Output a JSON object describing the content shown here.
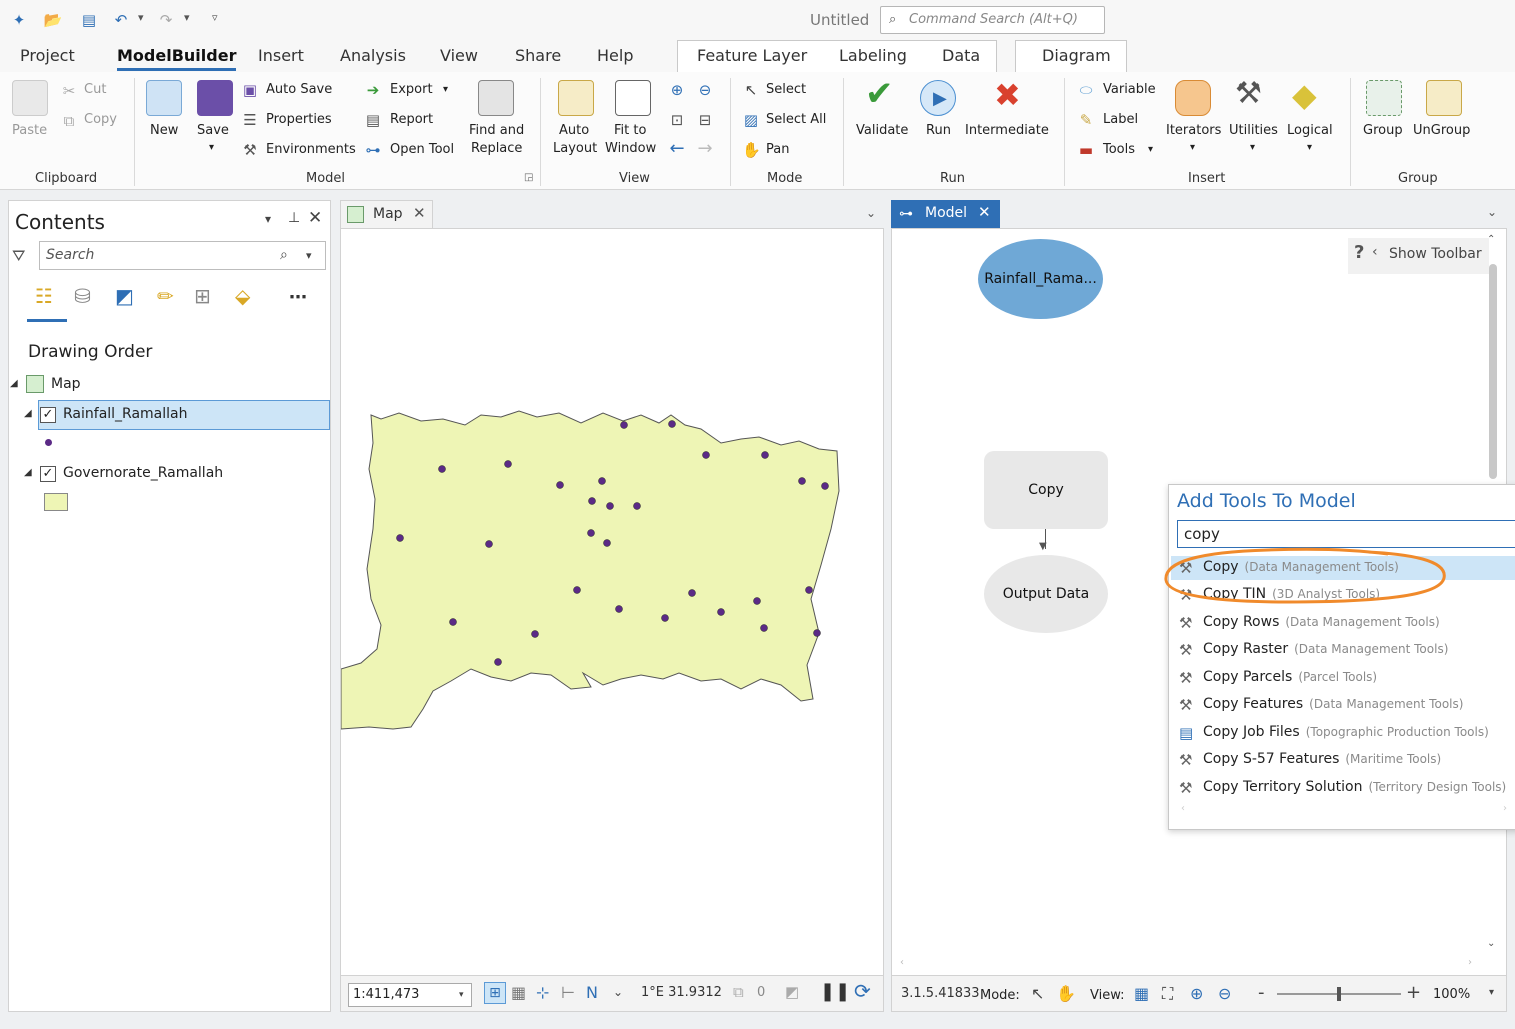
{
  "app": {
    "title": "Untitled",
    "command_search_placeholder": "Command Search (Alt+Q)"
  },
  "tabs": [
    "Project",
    "ModelBuilder",
    "Insert",
    "Analysis",
    "View",
    "Share",
    "Help"
  ],
  "context_tabs": [
    "Feature Layer",
    "Labeling",
    "Data"
  ],
  "diagram_tab": "Diagram",
  "ribbon": {
    "clipboard": {
      "paste": "Paste",
      "cut": "Cut",
      "copy": "Copy",
      "group": "Clipboard"
    },
    "model": {
      "new": "New",
      "save": "Save",
      "auto_save": "Auto Save",
      "properties": "Properties",
      "environments": "Environments",
      "export": "Export",
      "report": "Report",
      "open_tool": "Open Tool",
      "find_and": "Find and",
      "replace": "Replace",
      "group": "Model"
    },
    "view": {
      "auto": "Auto",
      "layout": "Layout",
      "fit_to": "Fit to",
      "window": "Window",
      "group": "View"
    },
    "mode": {
      "select": "Select",
      "select_all": "Select All",
      "pan": "Pan",
      "group": "Mode"
    },
    "run": {
      "validate": "Validate",
      "run": "Run",
      "intermediate": "Intermediate",
      "group": "Run"
    },
    "insert": {
      "variable": "Variable",
      "label": "Label",
      "tools": "Tools",
      "iterators": "Iterators",
      "utilities": "Utilities",
      "logical": "Logical",
      "group": "Insert"
    },
    "grouping": {
      "group_btn": "Group",
      "ungroup": "UnGroup",
      "group": "Group"
    }
  },
  "contents": {
    "title": "Contents",
    "search_placeholder": "Search",
    "drawing_order": "Drawing Order",
    "map_item": "Map",
    "layers": [
      "Rainfall_Ramallah",
      "Governorate_Ramallah"
    ]
  },
  "map_view": {
    "tab": "Map",
    "scale": "1:411,473",
    "coords": "1°E 31.9312",
    "selected_count": "0"
  },
  "model_view": {
    "tab": "Model",
    "show_toolbar": "Show Toolbar",
    "help": "?",
    "nodes": {
      "input": "Rainfall_Rama...",
      "tool": "Copy",
      "output": "Output Data"
    },
    "status_coords": "3.1.5.41833",
    "mode_label": "Mode:",
    "view_label": "View:",
    "zoom": "100%"
  },
  "add_tools": {
    "title": "Add Tools To Model",
    "query": "copy",
    "results": [
      {
        "name": "Copy",
        "category": "(Data Management Tools)"
      },
      {
        "name": "Copy TIN",
        "category": "(3D Analyst Tools)"
      },
      {
        "name": "Copy Rows",
        "category": "(Data Management Tools)"
      },
      {
        "name": "Copy Raster",
        "category": "(Data Management Tools)"
      },
      {
        "name": "Copy Parcels",
        "category": "(Parcel Tools)"
      },
      {
        "name": "Copy Features",
        "category": "(Data Management Tools)"
      },
      {
        "name": "Copy Job Files",
        "category": "(Topographic Production Tools)"
      },
      {
        "name": "Copy S-57 Features",
        "category": "(Maritime Tools)"
      },
      {
        "name": "Copy Territory Solution",
        "category": "(Territory Design Tools)"
      }
    ]
  },
  "colors": {
    "accent": "#2f6fb5",
    "polygon_fill": "#eef5b5",
    "point": "#5b2a86",
    "model_input": "#6fa8d6",
    "highlight": "#cde5f7",
    "annotation": "#f08a2b"
  }
}
